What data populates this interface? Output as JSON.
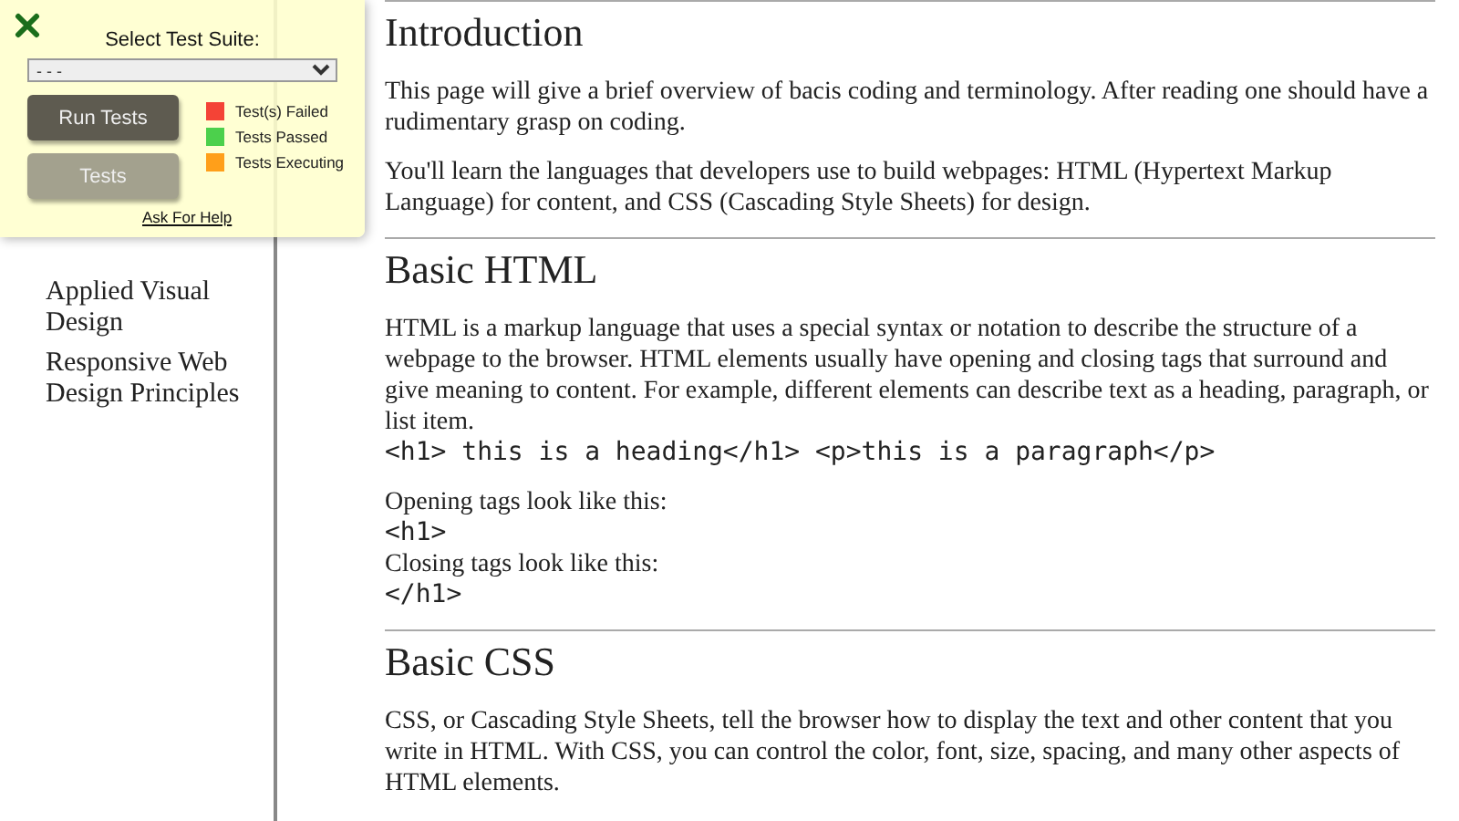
{
  "sidebar": {
    "items": [
      {
        "label": "Applied Visual Design"
      },
      {
        "label": "Responsive Web Design Principles"
      }
    ]
  },
  "test_panel": {
    "select_label": "Select Test Suite:",
    "select_value": "- - -",
    "buttons": [
      {
        "label": "Run Tests",
        "kind": "primary"
      },
      {
        "label": "Tests",
        "kind": "secondary"
      }
    ],
    "legend": [
      {
        "label": "Test(s) Failed",
        "color": "#f44336"
      },
      {
        "label": "Tests Passed",
        "color": "#4cd04c"
      },
      {
        "label": "Tests Executing",
        "color": "#ff9f1a"
      }
    ],
    "help_link": "Ask For Help"
  },
  "sections": [
    {
      "heading": "Introduction",
      "paragraphs": [
        [
          {
            "kind": "text",
            "text": "This page will give a brief overview of bacis coding and terminology. After reading one should have a rudimentary grasp on coding."
          }
        ],
        [
          {
            "kind": "text",
            "text": "You'll learn the languages that developers use to build webpages: HTML (Hypertext Markup Language) for content, and CSS (Cascading Style Sheets) for design."
          }
        ]
      ]
    },
    {
      "heading": "Basic HTML",
      "paragraphs": [
        [
          {
            "kind": "text",
            "text": "HTML is a markup language that uses a special syntax or notation to describe the structure of a webpage to the browser. HTML elements usually have opening and closing tags that surround and give meaning to content. For example, different elements can describe text as a heading, paragraph, or list item."
          },
          {
            "kind": "code",
            "text": "<h1> this is a heading</h1> <p>this is a paragraph</p>"
          }
        ],
        [
          {
            "kind": "text",
            "text": "Opening tags look like this:"
          },
          {
            "kind": "code",
            "text": "<h1>"
          },
          {
            "kind": "text",
            "text": "Closing tags look like this:"
          },
          {
            "kind": "code",
            "text": "</h1>"
          }
        ]
      ]
    },
    {
      "heading": "Basic CSS",
      "paragraphs": [
        [
          {
            "kind": "text",
            "text": "CSS, or Cascading Style Sheets, tell the browser how to display the text and other content that you write in HTML. With CSS, you can control the color, font, size, spacing, and many other aspects of HTML elements."
          }
        ]
      ]
    }
  ]
}
